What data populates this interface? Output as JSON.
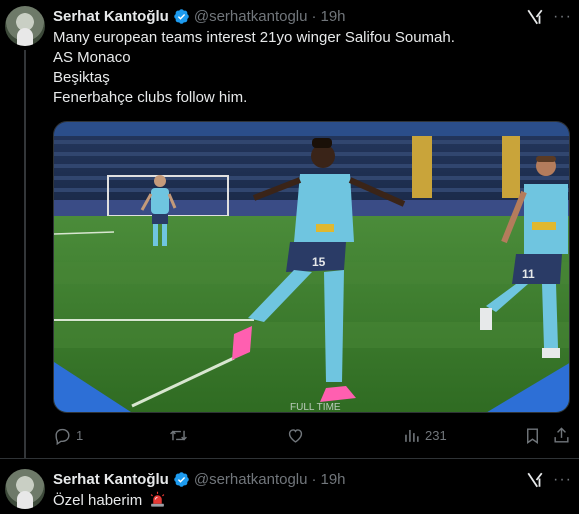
{
  "tweets": [
    {
      "author": {
        "name": "Serhat Kantoğlu",
        "handle": "@serhatkantoglu",
        "verified": true
      },
      "separator": "·",
      "time": "19h",
      "lines": [
        "Many european teams interest 21yo winger Salifou Soumah.",
        "AS Monaco",
        "Beşiktaş",
        "Fenerbahçe clubs follow him."
      ],
      "media": {
        "type": "photo",
        "watermark": "FULL TIME",
        "jersey_numbers": [
          "15",
          "11"
        ]
      },
      "stats": {
        "replies": "1",
        "retweets": "",
        "likes": "",
        "views": "231"
      }
    },
    {
      "author": {
        "name": "Serhat Kantoğlu",
        "handle": "@serhatkantoglu",
        "verified": true
      },
      "separator": "·",
      "time": "19h",
      "text": "Özel haberim",
      "emoji": "siren"
    }
  ],
  "icons": [
    "verified-badge-icon",
    "grok-icon",
    "more-icon",
    "reply-icon",
    "retweet-icon",
    "like-icon",
    "views-icon",
    "bookmark-icon",
    "share-icon"
  ],
  "colors": {
    "background": "#000000",
    "text": "#e7e9ea",
    "muted": "#71767b",
    "verified": "#1d9bf0",
    "divider": "#2f3336"
  }
}
